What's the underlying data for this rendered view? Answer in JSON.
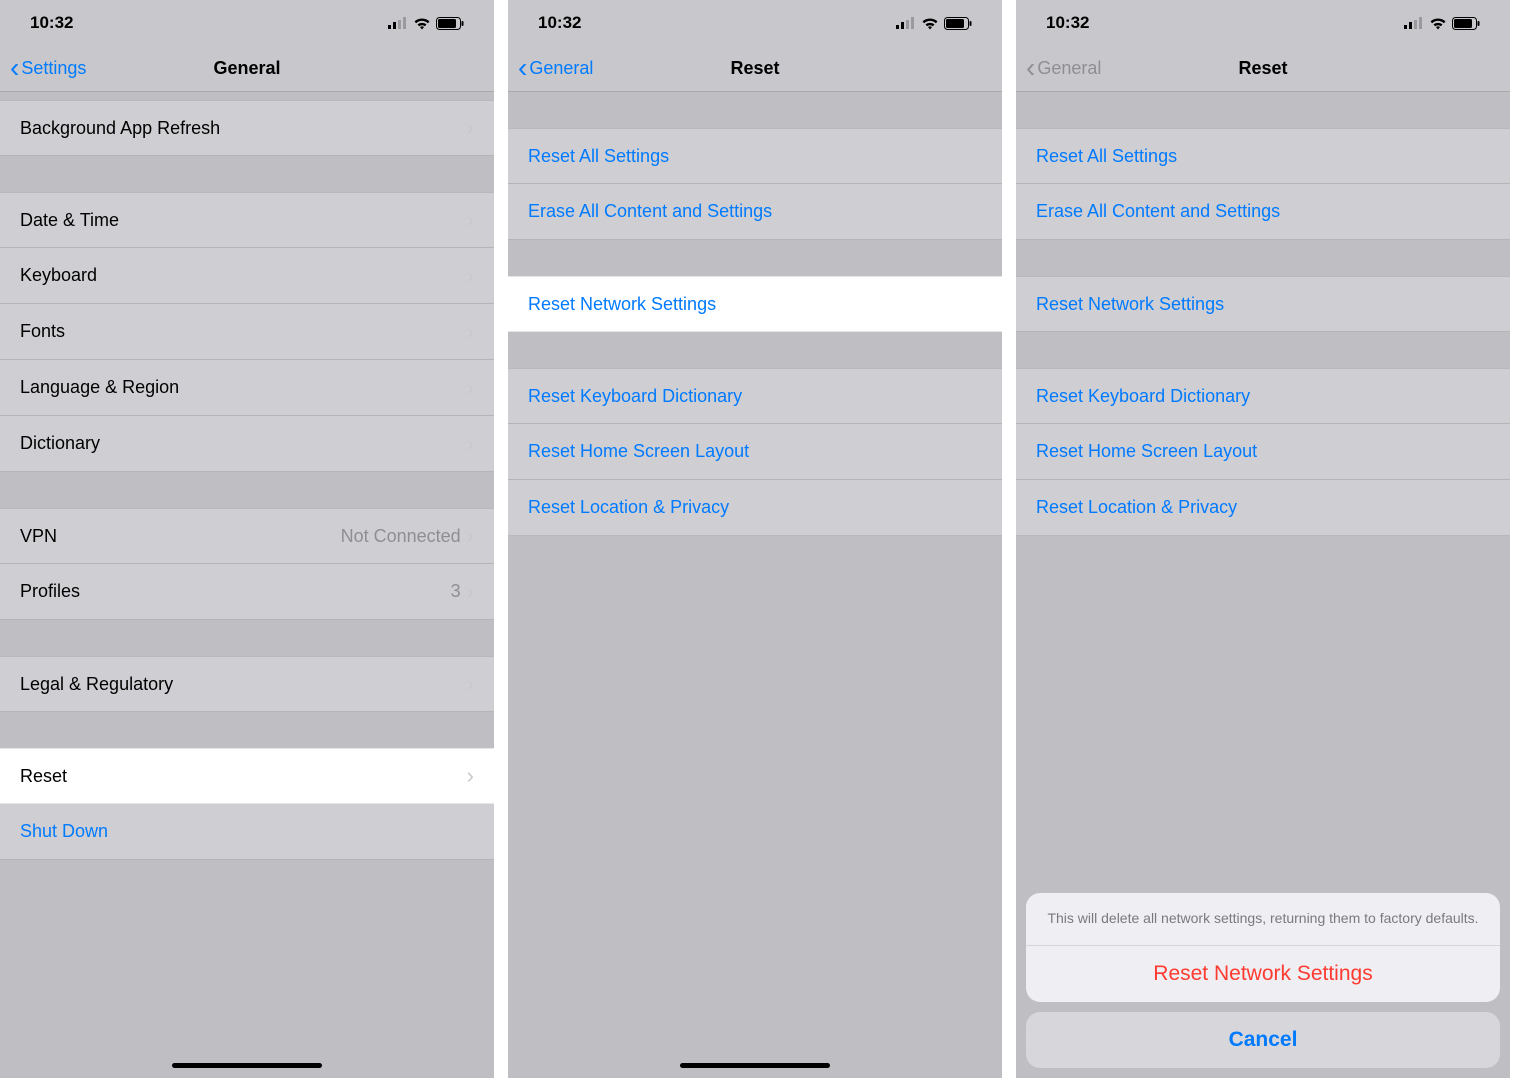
{
  "status": {
    "time": "10:32"
  },
  "screen1": {
    "back": "Settings",
    "title": "General",
    "rows": {
      "bg_app_refresh": "Background App Refresh",
      "date_time": "Date & Time",
      "keyboard": "Keyboard",
      "fonts": "Fonts",
      "lang_region": "Language & Region",
      "dictionary": "Dictionary",
      "vpn": "VPN",
      "vpn_value": "Not Connected",
      "profiles": "Profiles",
      "profiles_value": "3",
      "legal": "Legal & Regulatory",
      "reset": "Reset",
      "shut_down": "Shut Down"
    }
  },
  "screen2": {
    "back": "General",
    "title": "Reset",
    "rows": {
      "reset_all": "Reset All Settings",
      "erase_all": "Erase All Content and Settings",
      "reset_network": "Reset Network Settings",
      "reset_keyboard": "Reset Keyboard Dictionary",
      "reset_home": "Reset Home Screen Layout",
      "reset_location": "Reset Location & Privacy"
    }
  },
  "screen3": {
    "back": "General",
    "title": "Reset",
    "rows": {
      "reset_all": "Reset All Settings",
      "erase_all": "Erase All Content and Settings",
      "reset_network": "Reset Network Settings",
      "reset_keyboard": "Reset Keyboard Dictionary",
      "reset_home": "Reset Home Screen Layout",
      "reset_location": "Reset Location & Privacy"
    },
    "sheet": {
      "message": "This will delete all network settings, returning them to factory defaults.",
      "action": "Reset Network Settings",
      "cancel": "Cancel"
    }
  }
}
